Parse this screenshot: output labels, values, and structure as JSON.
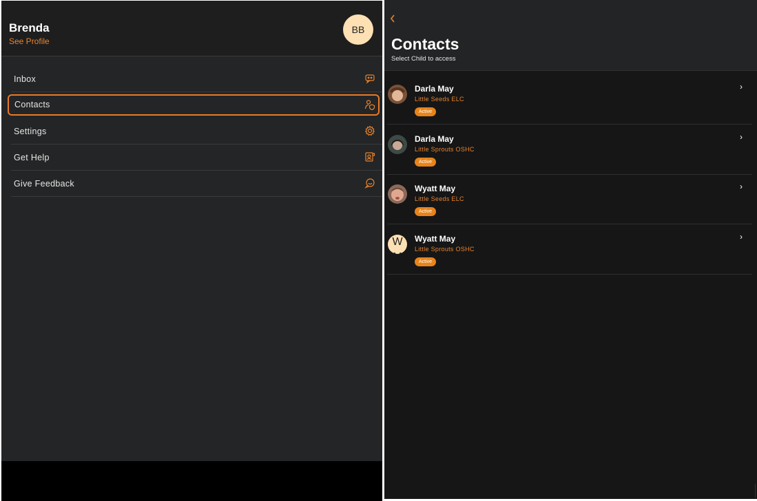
{
  "sidebar": {
    "user_name": "Brenda",
    "see_profile": "See Profile",
    "avatar_initials": "BB",
    "items": [
      {
        "label": "Inbox",
        "icon": "inbox-chat-icon"
      },
      {
        "label": "Contacts",
        "icon": "contacts-shield-icon"
      },
      {
        "label": "Settings",
        "icon": "gear-icon"
      },
      {
        "label": "Get Help",
        "icon": "help-icon"
      },
      {
        "label": "Give Feedback",
        "icon": "feedback-chat-icon"
      }
    ]
  },
  "contacts": {
    "back_icon": "chevron-left-icon",
    "title": "Contacts",
    "subtitle": "Select Child to access",
    "list": [
      {
        "name": "Darla May",
        "center": "Little Seeds ELC",
        "status": "Active"
      },
      {
        "name": "Darla May",
        "center": "Little Sprouts OSHC",
        "status": "Active"
      },
      {
        "name": "Wyatt May",
        "center": "Little Seeds ELC",
        "status": "Active"
      },
      {
        "name": "Wyatt May",
        "center": "Little Sprouts OSHC",
        "status": "Active",
        "initials": "W\nM"
      }
    ],
    "chevron": "›"
  },
  "colors": {
    "accent": "#e8842c",
    "sidebar_bg": "#242526",
    "panel_bg": "#161617"
  }
}
